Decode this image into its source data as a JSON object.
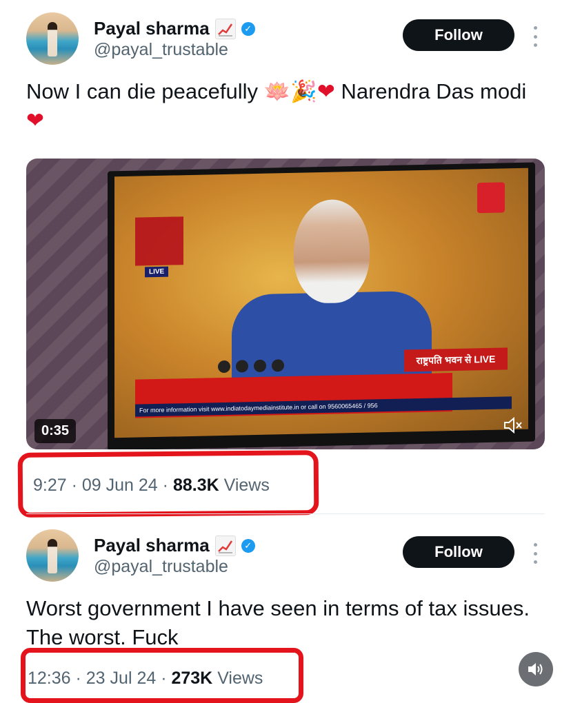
{
  "tweets": [
    {
      "author_name": "Payal sharma",
      "handle": "@payal_trustable",
      "follow_label": "Follow",
      "text_before": "Now I can die peacefully ",
      "emojis": "🪷🎉",
      "text_mid": "  Narendra Das modi ",
      "video_duration": "0:35",
      "video_channel_live": "LIVE",
      "video_banner": "राष्ट्रपति भवन से LIVE",
      "video_ticker": "For more information visit www.indiatodaymediainstitute.in or call on 9560065465 / 956",
      "time": "9:27",
      "date": "09 Jun 24",
      "views_count": "88.3K",
      "views_label": "Views"
    },
    {
      "author_name": "Payal sharma",
      "handle": "@payal_trustable",
      "follow_label": "Follow",
      "text": "Worst government I have seen in terms of tax issues. The worst. Fuck",
      "time": "12:36",
      "date": "23 Jul 24",
      "views_count": "273K",
      "views_label": "Views"
    }
  ],
  "meta_separator": " · ",
  "colors": {
    "follow_bg": "#0f1419",
    "verified": "#1d9bf0",
    "highlight": "#e3141b",
    "secondary_text": "#536471"
  },
  "icons": [
    "chart-increasing-icon",
    "verified-badge-icon",
    "more-options-icon",
    "mute-icon",
    "sound-icon",
    "heart-icon"
  ]
}
